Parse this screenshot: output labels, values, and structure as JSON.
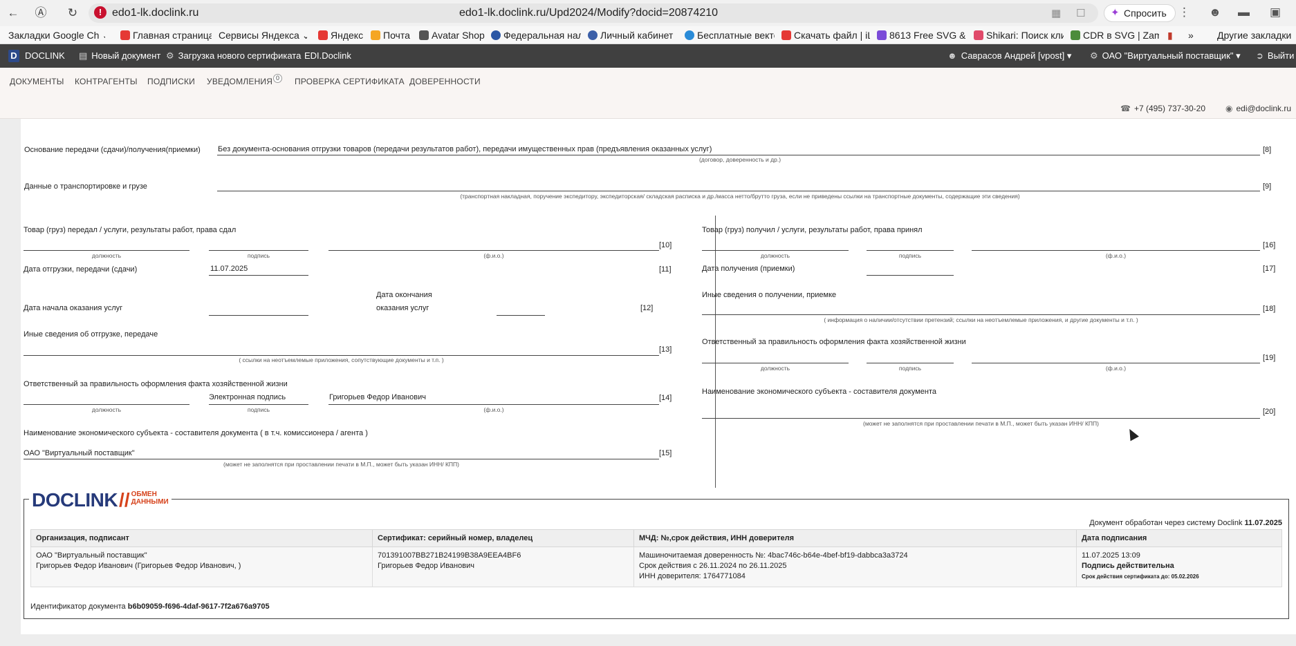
{
  "browser": {
    "url_domain": "edo1-lk.doclink.ru",
    "url_full": "edo1-lk.doclink.ru/Upd2024/Modify?docid=20874210",
    "ask_label": "Спросить",
    "bookmarks": [
      {
        "label": "Закладки Google Ch",
        "color": "#f1f1f1"
      },
      {
        "label": "Главная страница",
        "color": "#e53935"
      },
      {
        "label": "Сервисы Яндекса",
        "color": "#f1f1f1"
      },
      {
        "label": "Яндекс",
        "color": "#e53935"
      },
      {
        "label": "Почта",
        "color": "#f5a623"
      },
      {
        "label": "Avatar Shop",
        "color": "#555555"
      },
      {
        "label": "Федеральная нал",
        "color": "#2b57a5"
      },
      {
        "label": "Личный кабинет",
        "color": "#3b5fa8"
      },
      {
        "label": "Бесплатные векто",
        "color": "#2a8bd8"
      },
      {
        "label": "Скачать файл | iL",
        "color": "#e53935"
      },
      {
        "label": "8613 Free SVG & F",
        "color": "#7b4bd8"
      },
      {
        "label": "Shikari: Поиск кли",
        "color": "#e04a6a"
      },
      {
        "label": "CDR в SVG | Zama",
        "color": "#4c8c3b"
      },
      {
        "label": "Другие закладки",
        "color": "#f1f1f1"
      }
    ]
  },
  "app": {
    "logo": "D",
    "brand": "DOCLINK",
    "new_doc": "Новый документ",
    "upload_cert": "Загрузка нового сертификата",
    "edi": "EDI.Doclink",
    "user": "Саврасов Андрей [vpost]",
    "org": "ОАО \"Виртуальный поставщик\"",
    "logout": "Выйти"
  },
  "tabs": {
    "documents": "ДОКУМЕНТЫ",
    "contractors": "КОНТРАГЕНТЫ",
    "subscriptions": "ПОДПИСКИ",
    "notifications": "УВЕДОМЛЕНИЯ",
    "notif_count": "0",
    "cert_check": "ПРОВЕРКА СЕРТИФИКАТА",
    "proxies": "ДОВЕРЕННОСТИ",
    "phone": "+7 (495) 737-30-20",
    "email": "edi@doclink.ru"
  },
  "form": {
    "basis_label": "Основание передачи (сдачи)/получения(приемки)",
    "basis_value": "Без документа-основания отгрузки товаров (передачи результатов работ), передачи имущественных прав (предъявления оказанных услуг)",
    "basis_note": "(договор, доверенность и др.)",
    "ref8": "[8]",
    "transport_label": "Данные о транспортировке и грузе",
    "transport_note": "(транспортная накладная, поручение экспедитору, экспедиторская/ складская расписка и др./масса нетто/брутто груза, если не приведены ссылки на транспортные документы, содержащие эти сведения)",
    "ref9": "[9]",
    "left": {
      "handed_label": "Товар (груз) передал / услуги, результаты работ, права сдал",
      "position": "должность",
      "signature": "подпись",
      "fio": "(ф.и.о.)",
      "ref10": "[10]",
      "ship_date_label": "Дата отгрузки, передачи (сдачи)",
      "ship_date_value": "11.07.2025",
      "ref11": "[11]",
      "start_label": "Дата начала оказания услуг",
      "end_label_1": "Дата окончания",
      "end_label_2": "оказания услуг",
      "ref12": "[12]",
      "other_label": "Иные сведения об отгрузке, передаче",
      "other_note": "( ссылки на неотъемлемые приложения, сопутствующие документы и т.п. )",
      "ref13": "[13]",
      "resp_label": "Ответственный за правильность оформления факта хозяйственной жизни",
      "resp_signature": "Электронная подпись",
      "resp_fio": "Григорьев Федор Иванович",
      "ref14": "[14]",
      "entity_label": "Наименование экономического субъекта - составителя документа ( в т.ч. комиссионера / агента )",
      "entity_value": "ОАО \"Виртуальный поставщик\"",
      "entity_note": "(может не заполнятся при проставлении печати в М.П., может быть указан ИНН/ КПП)",
      "ref15": "[15]"
    },
    "right": {
      "received_label": "Товар (груз) получил / услуги, результаты работ, права принял",
      "ref16": "[16]",
      "recv_date_label": "Дата получения (приемки)",
      "ref17": "[17]",
      "other_label": "Иные сведения о получении, приемке",
      "other_note": "( информация о наличии/отсутствии претензий; ссылки на неотъемлемые приложения, и другие документы и т.п. )",
      "ref18": "[18]",
      "resp_label": "Ответственный за правильность оформления факта хозяйственной жизни",
      "ref19": "[19]",
      "entity_label": "Наименование экономического субъекта - составителя документа",
      "entity_note": "(может не заполнятся при проставлении печати в М.П., может быть указан ИНН/ КПП)",
      "ref20": "[20]"
    }
  },
  "signature_block": {
    "logo_text": "DOCLINK",
    "logo_tag_1": "ОБМЕН",
    "logo_tag_2": "ДАННЫМИ",
    "processed_prefix": "Документ обработан через систему Doclink",
    "processed_date": "11.07.2025",
    "headers": [
      "Организация, подписант",
      "Сертификат: серийный номер, владелец",
      "МЧД: №,срок действия, ИНН доверителя",
      "Дата подписания"
    ],
    "org_line1": "ОАО \"Виртуальный поставщик\"",
    "org_line2": "Григорьев Федор Иванович (Григорьев Федор Иванович, )",
    "cert_serial": "701391007BB271B24199B38A9EEA4BF6",
    "cert_owner": "Григорьев Федор Иванович",
    "mchd_line1": "Машиночитаемая доверенность №: 4bac746c-b64e-4bef-bf19-dabbca3a3724",
    "mchd_line2": "Срок действия с 26.11.2024 по 26.11.2025",
    "mchd_line3": "ИНН доверителя: 1764771084",
    "sign_datetime": "11.07.2025 13:09",
    "sign_valid": "Подпись действительна",
    "cert_valid_until": "Срок действия сертификата до: 05.02.2026",
    "doc_id_label": "Идентификатор документа",
    "doc_id_value": "b6b09059-f696-4daf-9617-7f2a676a9705"
  },
  "colors": {
    "app_bar": "#404040",
    "brand_blue": "#263a7a",
    "brand_orange": "#d6431c",
    "alert_red": "#c8102e"
  }
}
